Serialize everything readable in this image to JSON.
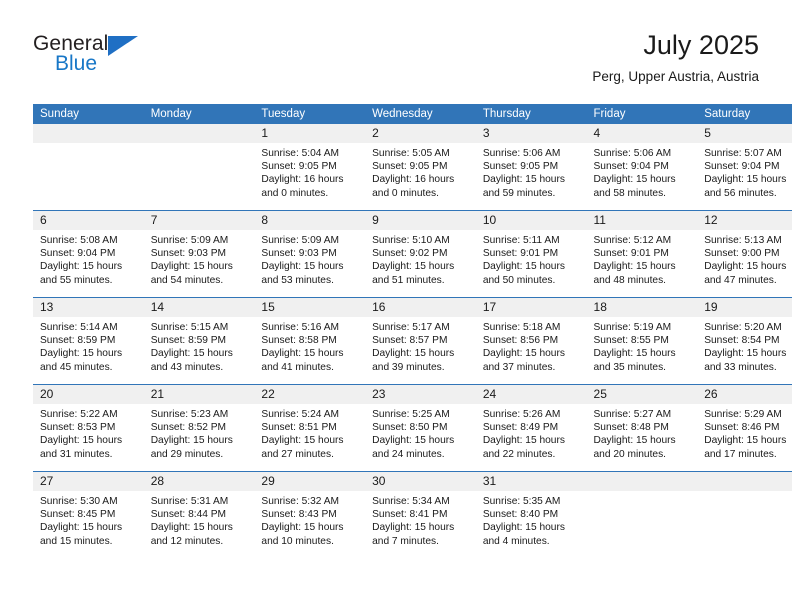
{
  "brand": {
    "name_part1": "General",
    "name_part2": "Blue",
    "logo_icon": "triangle-logo-icon"
  },
  "header": {
    "month_title": "July 2025",
    "location": "Perg, Upper Austria, Austria"
  },
  "colors": {
    "header_blue": "#3175b8",
    "brand_blue": "#1877c7",
    "daynum_band": "#f0f0f0",
    "text": "#1a1a1a"
  },
  "calendar": {
    "weekday_headers": [
      "Sunday",
      "Monday",
      "Tuesday",
      "Wednesday",
      "Thursday",
      "Friday",
      "Saturday"
    ],
    "weeks": [
      [
        {
          "day": "",
          "empty": true,
          "sunrise": "",
          "sunset": "",
          "daylight_line1": "",
          "daylight_line2": ""
        },
        {
          "day": "",
          "empty": true,
          "sunrise": "",
          "sunset": "",
          "daylight_line1": "",
          "daylight_line2": ""
        },
        {
          "day": "1",
          "empty": false,
          "sunrise": "Sunrise: 5:04 AM",
          "sunset": "Sunset: 9:05 PM",
          "daylight_line1": "Daylight: 16 hours",
          "daylight_line2": "and 0 minutes."
        },
        {
          "day": "2",
          "empty": false,
          "sunrise": "Sunrise: 5:05 AM",
          "sunset": "Sunset: 9:05 PM",
          "daylight_line1": "Daylight: 16 hours",
          "daylight_line2": "and 0 minutes."
        },
        {
          "day": "3",
          "empty": false,
          "sunrise": "Sunrise: 5:06 AM",
          "sunset": "Sunset: 9:05 PM",
          "daylight_line1": "Daylight: 15 hours",
          "daylight_line2": "and 59 minutes."
        },
        {
          "day": "4",
          "empty": false,
          "sunrise": "Sunrise: 5:06 AM",
          "sunset": "Sunset: 9:04 PM",
          "daylight_line1": "Daylight: 15 hours",
          "daylight_line2": "and 58 minutes."
        },
        {
          "day": "5",
          "empty": false,
          "sunrise": "Sunrise: 5:07 AM",
          "sunset": "Sunset: 9:04 PM",
          "daylight_line1": "Daylight: 15 hours",
          "daylight_line2": "and 56 minutes."
        }
      ],
      [
        {
          "day": "6",
          "empty": false,
          "sunrise": "Sunrise: 5:08 AM",
          "sunset": "Sunset: 9:04 PM",
          "daylight_line1": "Daylight: 15 hours",
          "daylight_line2": "and 55 minutes."
        },
        {
          "day": "7",
          "empty": false,
          "sunrise": "Sunrise: 5:09 AM",
          "sunset": "Sunset: 9:03 PM",
          "daylight_line1": "Daylight: 15 hours",
          "daylight_line2": "and 54 minutes."
        },
        {
          "day": "8",
          "empty": false,
          "sunrise": "Sunrise: 5:09 AM",
          "sunset": "Sunset: 9:03 PM",
          "daylight_line1": "Daylight: 15 hours",
          "daylight_line2": "and 53 minutes."
        },
        {
          "day": "9",
          "empty": false,
          "sunrise": "Sunrise: 5:10 AM",
          "sunset": "Sunset: 9:02 PM",
          "daylight_line1": "Daylight: 15 hours",
          "daylight_line2": "and 51 minutes."
        },
        {
          "day": "10",
          "empty": false,
          "sunrise": "Sunrise: 5:11 AM",
          "sunset": "Sunset: 9:01 PM",
          "daylight_line1": "Daylight: 15 hours",
          "daylight_line2": "and 50 minutes."
        },
        {
          "day": "11",
          "empty": false,
          "sunrise": "Sunrise: 5:12 AM",
          "sunset": "Sunset: 9:01 PM",
          "daylight_line1": "Daylight: 15 hours",
          "daylight_line2": "and 48 minutes."
        },
        {
          "day": "12",
          "empty": false,
          "sunrise": "Sunrise: 5:13 AM",
          "sunset": "Sunset: 9:00 PM",
          "daylight_line1": "Daylight: 15 hours",
          "daylight_line2": "and 47 minutes."
        }
      ],
      [
        {
          "day": "13",
          "empty": false,
          "sunrise": "Sunrise: 5:14 AM",
          "sunset": "Sunset: 8:59 PM",
          "daylight_line1": "Daylight: 15 hours",
          "daylight_line2": "and 45 minutes."
        },
        {
          "day": "14",
          "empty": false,
          "sunrise": "Sunrise: 5:15 AM",
          "sunset": "Sunset: 8:59 PM",
          "daylight_line1": "Daylight: 15 hours",
          "daylight_line2": "and 43 minutes."
        },
        {
          "day": "15",
          "empty": false,
          "sunrise": "Sunrise: 5:16 AM",
          "sunset": "Sunset: 8:58 PM",
          "daylight_line1": "Daylight: 15 hours",
          "daylight_line2": "and 41 minutes."
        },
        {
          "day": "16",
          "empty": false,
          "sunrise": "Sunrise: 5:17 AM",
          "sunset": "Sunset: 8:57 PM",
          "daylight_line1": "Daylight: 15 hours",
          "daylight_line2": "and 39 minutes."
        },
        {
          "day": "17",
          "empty": false,
          "sunrise": "Sunrise: 5:18 AM",
          "sunset": "Sunset: 8:56 PM",
          "daylight_line1": "Daylight: 15 hours",
          "daylight_line2": "and 37 minutes."
        },
        {
          "day": "18",
          "empty": false,
          "sunrise": "Sunrise: 5:19 AM",
          "sunset": "Sunset: 8:55 PM",
          "daylight_line1": "Daylight: 15 hours",
          "daylight_line2": "and 35 minutes."
        },
        {
          "day": "19",
          "empty": false,
          "sunrise": "Sunrise: 5:20 AM",
          "sunset": "Sunset: 8:54 PM",
          "daylight_line1": "Daylight: 15 hours",
          "daylight_line2": "and 33 minutes."
        }
      ],
      [
        {
          "day": "20",
          "empty": false,
          "sunrise": "Sunrise: 5:22 AM",
          "sunset": "Sunset: 8:53 PM",
          "daylight_line1": "Daylight: 15 hours",
          "daylight_line2": "and 31 minutes."
        },
        {
          "day": "21",
          "empty": false,
          "sunrise": "Sunrise: 5:23 AM",
          "sunset": "Sunset: 8:52 PM",
          "daylight_line1": "Daylight: 15 hours",
          "daylight_line2": "and 29 minutes."
        },
        {
          "day": "22",
          "empty": false,
          "sunrise": "Sunrise: 5:24 AM",
          "sunset": "Sunset: 8:51 PM",
          "daylight_line1": "Daylight: 15 hours",
          "daylight_line2": "and 27 minutes."
        },
        {
          "day": "23",
          "empty": false,
          "sunrise": "Sunrise: 5:25 AM",
          "sunset": "Sunset: 8:50 PM",
          "daylight_line1": "Daylight: 15 hours",
          "daylight_line2": "and 24 minutes."
        },
        {
          "day": "24",
          "empty": false,
          "sunrise": "Sunrise: 5:26 AM",
          "sunset": "Sunset: 8:49 PM",
          "daylight_line1": "Daylight: 15 hours",
          "daylight_line2": "and 22 minutes."
        },
        {
          "day": "25",
          "empty": false,
          "sunrise": "Sunrise: 5:27 AM",
          "sunset": "Sunset: 8:48 PM",
          "daylight_line1": "Daylight: 15 hours",
          "daylight_line2": "and 20 minutes."
        },
        {
          "day": "26",
          "empty": false,
          "sunrise": "Sunrise: 5:29 AM",
          "sunset": "Sunset: 8:46 PM",
          "daylight_line1": "Daylight: 15 hours",
          "daylight_line2": "and 17 minutes."
        }
      ],
      [
        {
          "day": "27",
          "empty": false,
          "sunrise": "Sunrise: 5:30 AM",
          "sunset": "Sunset: 8:45 PM",
          "daylight_line1": "Daylight: 15 hours",
          "daylight_line2": "and 15 minutes."
        },
        {
          "day": "28",
          "empty": false,
          "sunrise": "Sunrise: 5:31 AM",
          "sunset": "Sunset: 8:44 PM",
          "daylight_line1": "Daylight: 15 hours",
          "daylight_line2": "and 12 minutes."
        },
        {
          "day": "29",
          "empty": false,
          "sunrise": "Sunrise: 5:32 AM",
          "sunset": "Sunset: 8:43 PM",
          "daylight_line1": "Daylight: 15 hours",
          "daylight_line2": "and 10 minutes."
        },
        {
          "day": "30",
          "empty": false,
          "sunrise": "Sunrise: 5:34 AM",
          "sunset": "Sunset: 8:41 PM",
          "daylight_line1": "Daylight: 15 hours",
          "daylight_line2": "and 7 minutes."
        },
        {
          "day": "31",
          "empty": false,
          "sunrise": "Sunrise: 5:35 AM",
          "sunset": "Sunset: 8:40 PM",
          "daylight_line1": "Daylight: 15 hours",
          "daylight_line2": "and 4 minutes."
        },
        {
          "day": "",
          "empty": true,
          "sunrise": "",
          "sunset": "",
          "daylight_line1": "",
          "daylight_line2": ""
        },
        {
          "day": "",
          "empty": true,
          "sunrise": "",
          "sunset": "",
          "daylight_line1": "",
          "daylight_line2": ""
        }
      ]
    ]
  }
}
